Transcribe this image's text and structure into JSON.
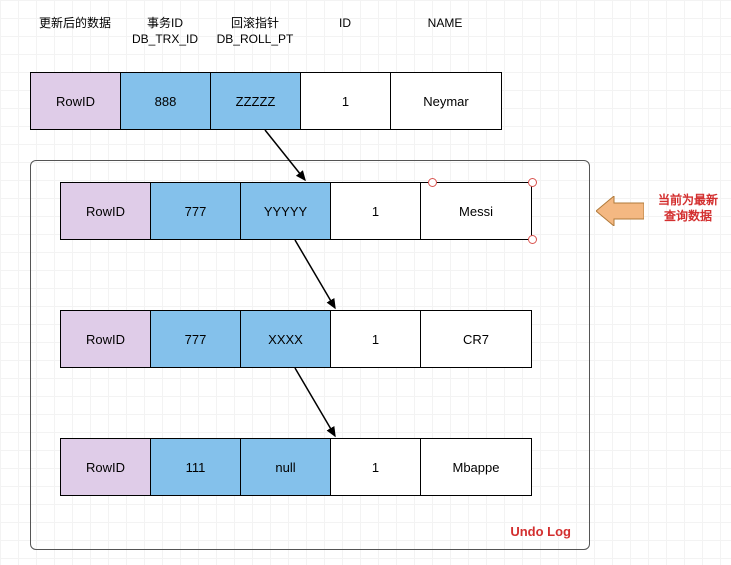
{
  "headers": {
    "rowid": "更新后的数据",
    "trx": "事务ID\nDB_TRX_ID",
    "roll": "回滚指针\nDB_ROLL_PT",
    "id": "ID",
    "name": "NAME"
  },
  "rows": [
    {
      "rowid": "RowID",
      "trx": "888",
      "roll": "ZZZZZ",
      "id": "1",
      "name": "Neymar"
    },
    {
      "rowid": "RowID",
      "trx": "777",
      "roll": "YYYYY",
      "id": "1",
      "name": "Messi"
    },
    {
      "rowid": "RowID",
      "trx": "777",
      "roll": "XXXX",
      "id": "1",
      "name": "CR7"
    },
    {
      "rowid": "RowID",
      "trx": "111",
      "roll": "null",
      "id": "1",
      "name": "Mbappe"
    }
  ],
  "undo_label": "Undo Log",
  "callout": "当前为最新\n查询数据"
}
